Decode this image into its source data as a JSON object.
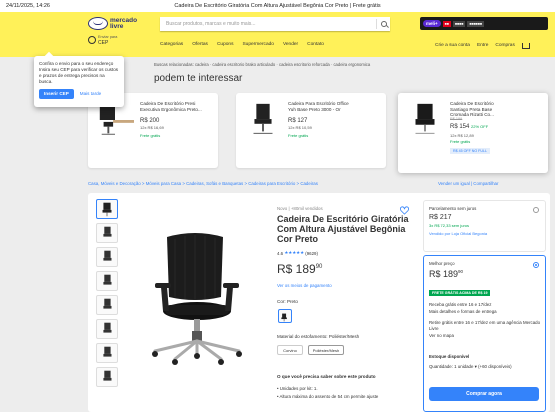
{
  "print": {
    "datetime": "24/11/2025, 14:26",
    "title": "Cadeira De Escritório Giratória Com Altura Ajustável Begônia Cor Preto | Frete grátis"
  },
  "header": {
    "logo_line1": "mercado",
    "logo_line2": "livre",
    "search_placeholder": "Buscar produtos, marcas e muito mais...",
    "promo_pill": "meli+",
    "location_line1": "Enviar para",
    "location_line2": "CEP",
    "nav": [
      "Categorias",
      "Ofertas",
      "Cupons",
      "Supermercado",
      "Vender",
      "Contato"
    ],
    "user_nav": [
      "Crie a sua conta",
      "Entre",
      "Compras"
    ]
  },
  "popup": {
    "text": "Confira o envio para o seu endereço Insira seu CEP para verificar os custos e prazos de entrega precisos na busca.",
    "primary": "Inserir CEP",
    "secondary": "Mais tarde"
  },
  "crumb_top": "Buscas relacionadas: cadeira · cadeira escritorio brako articulado · cadeira escritorio reforcada · cadeira ergonomica",
  "suggestions_title": "podem te interessar",
  "cards": [
    {
      "title": "Cadeira De Escritório Presi Executiva Ergonômica Preto...",
      "price": "R$ 200",
      "sub": "12x R$ 16,69",
      "free": "Frete grátis"
    },
    {
      "title": "Cadeira Para Escritório Office Yuh Base Preto 3000 - Or",
      "price": "R$ 127",
      "sub": "12x R$ 10,59",
      "free": "Frete grátis"
    },
    {
      "title": "Cadeira De Escritório Santiago Preta Base Cromada Rizatti Co...",
      "old": "R$ 199",
      "price": "R$ 154",
      "off": "22% OFF",
      "sub": "12x R$ 12,89",
      "free": "Frete grátis",
      "discount": "R$ 45 OFF NO FULL"
    }
  ],
  "crumb2": "Casa, Móveis e Decoração > Móveis para Casa > Cadeiras, Sofás e Banquetas > Cadeiras para Escritório > Cadeiras",
  "sellers": "Vender um igual | Compartilhar",
  "product": {
    "status": "Novo | +80mil vendidos",
    "title": "Cadeira De Escritório Giratória Com Altura Ajustável Begônia Cor Preto",
    "rating_value": "4.6",
    "rating_stars": "★★★★★",
    "rating_count": "(9629)",
    "price": "R$ 189",
    "price_cents": "90",
    "installments": "Ver os meios de pagamento",
    "color_label": "Cor: Preto",
    "material_label": "Material do estofamento: Poliéster/Mesh",
    "material_options": [
      "Corvino",
      "Poliéster/Mesh"
    ],
    "what_label": "O que você precisa saber sobre este produto",
    "bullets": [
      "• Unidades por kit: 1.",
      "• Altura máxima do assento de 54 cm permite ajuste"
    ]
  },
  "right": {
    "opt1_head": "Parcelamento sem juros",
    "opt1_price": "R$ 217",
    "opt1_sub": "3x R$ 72,33 sem juros",
    "opt1_seller": "Vendido por Loja Oficial Begonia",
    "opt2_head": "Melhor preço",
    "opt2_price": "R$ 189",
    "opt2_cents": "90",
    "full_badge": "FRETE GRÁTIS ACIMA DE R$ 19",
    "ship1": "Receba grátis entre 16 e 17/dez",
    "ship1_link": "Mais detalhes e formas de entrega",
    "ship2": "Retire grátis entre 16 e 17/dez em uma agência Mercado Livre",
    "ship2_link": "Ver no mapa",
    "stock": "Estoque disponível",
    "qty": "Quantidade: 1 unidade ▾ (+60 disponíveis)",
    "buy": "Comprar agora"
  }
}
